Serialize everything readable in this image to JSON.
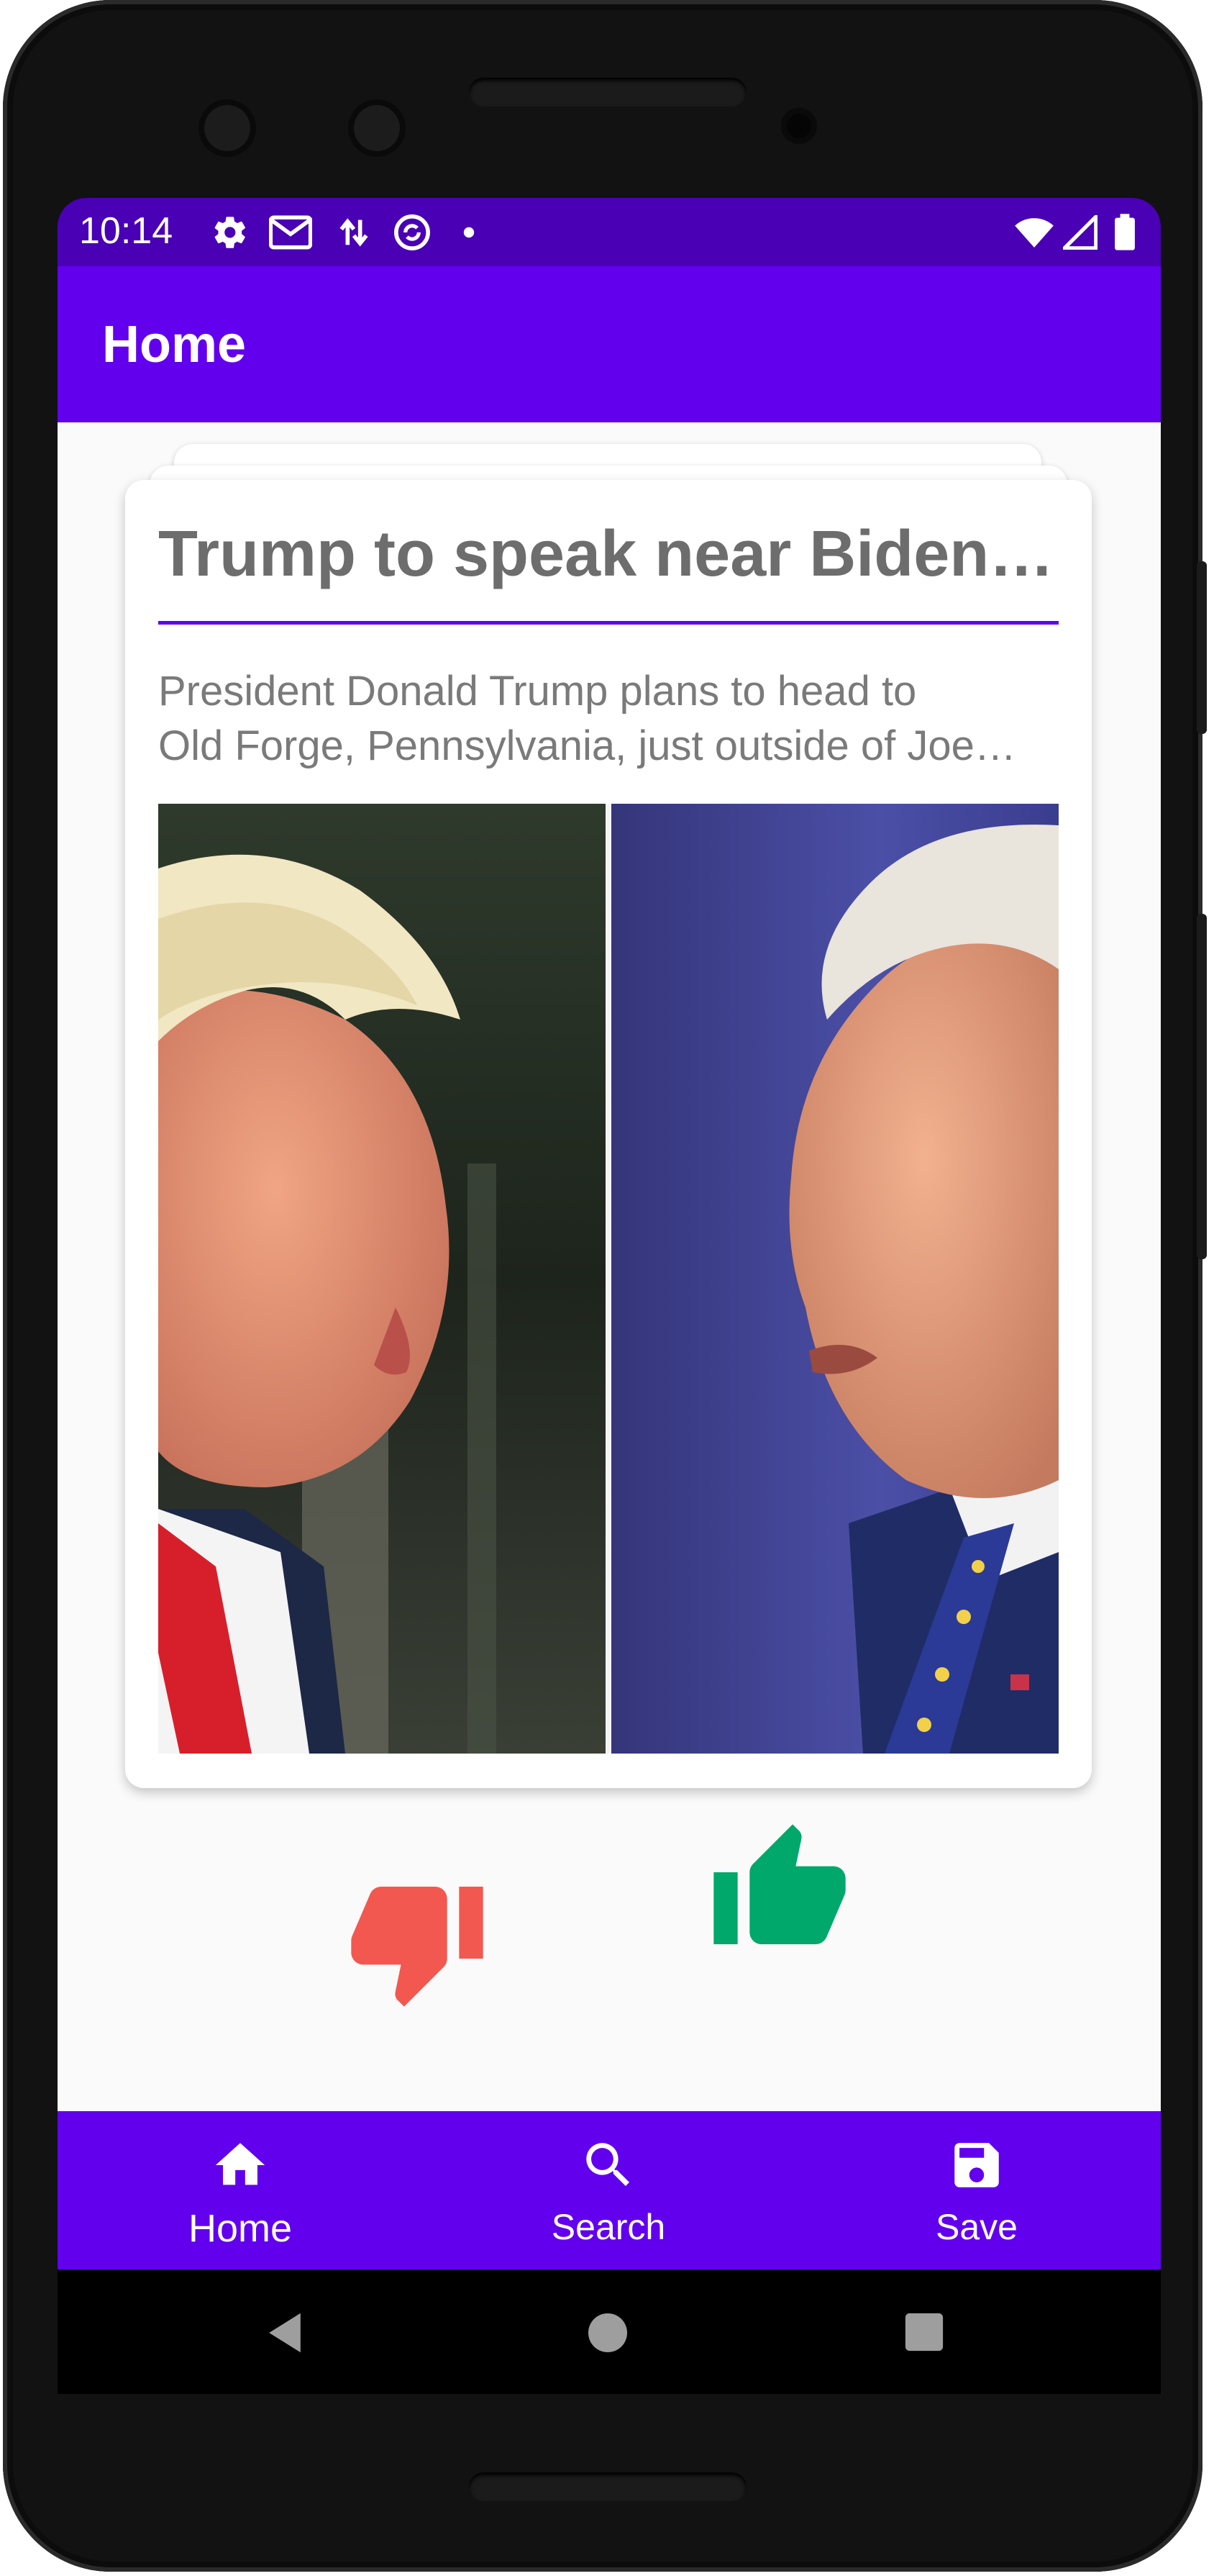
{
  "status_bar": {
    "time": "10:14",
    "icons": [
      "gear-icon",
      "gmail-icon",
      "data-arrows-icon",
      "sync-circle-icon",
      "dot-icon",
      "wifi-icon",
      "signal-icon",
      "battery-icon"
    ]
  },
  "app_bar": {
    "title": "Home"
  },
  "article_card": {
    "title": "Trump to speak near Biden'…",
    "description_line1": "President Donald Trump plans to head to",
    "description_line2": "Old Forge, Pennsylvania, just outside of Joe…",
    "image": "side-by-side-photo-trump-biden"
  },
  "actions": {
    "dislike": "thumbs-down-icon",
    "like": "thumbs-up-icon"
  },
  "bottom_nav": {
    "items": [
      {
        "label": "Home",
        "icon": "home-icon",
        "active": true
      },
      {
        "label": "Search",
        "icon": "search-icon",
        "active": false
      },
      {
        "label": "Save",
        "icon": "save-icon",
        "active": false
      }
    ]
  },
  "colors": {
    "status_bar": "#4a00b4",
    "primary": "#6200ee",
    "dislike": "#f2584f",
    "like": "#00a86b",
    "title_text": "#6d6d6d"
  }
}
